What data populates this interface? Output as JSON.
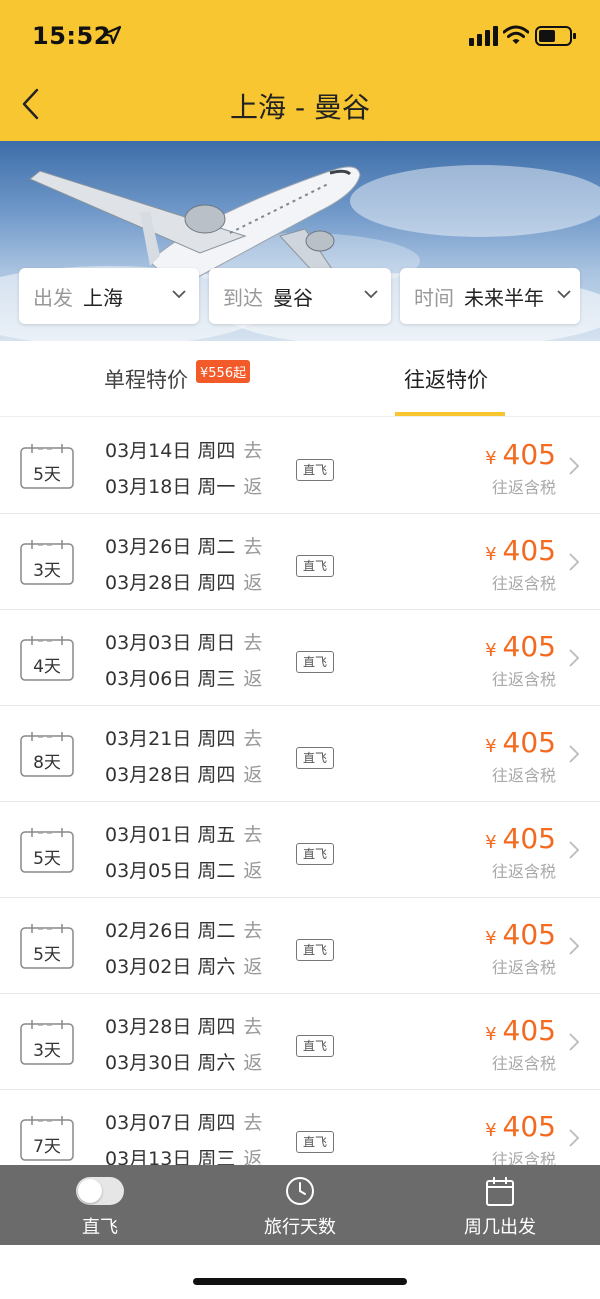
{
  "status_bar": {
    "time": "15:52"
  },
  "nav": {
    "title": "上海 - 曼谷"
  },
  "filters": [
    {
      "label": "出发",
      "value": "上海"
    },
    {
      "label": "到达",
      "value": "曼谷"
    },
    {
      "label": "时间",
      "value": "未来半年"
    }
  ],
  "tabs": {
    "one_way": {
      "label": "单程特价",
      "badge": "¥556起"
    },
    "round_trip": {
      "label": "往返特价",
      "selected": true
    }
  },
  "labels": {
    "go": "去",
    "return": "返",
    "direct": "直飞",
    "currency": "¥",
    "price_note": "往返含税"
  },
  "flights": [
    {
      "days": "5天",
      "depart": "03月14日 周四",
      "return": "03月18日 周一",
      "price": "405"
    },
    {
      "days": "3天",
      "depart": "03月26日 周二",
      "return": "03月28日 周四",
      "price": "405"
    },
    {
      "days": "4天",
      "depart": "03月03日 周日",
      "return": "03月06日 周三",
      "price": "405"
    },
    {
      "days": "8天",
      "depart": "03月21日 周四",
      "return": "03月28日 周四",
      "price": "405"
    },
    {
      "days": "5天",
      "depart": "03月01日 周五",
      "return": "03月05日 周二",
      "price": "405"
    },
    {
      "days": "5天",
      "depart": "02月26日 周二",
      "return": "03月02日 周六",
      "price": "405"
    },
    {
      "days": "3天",
      "depart": "03月28日 周四",
      "return": "03月30日 周六",
      "price": "405"
    },
    {
      "days": "7天",
      "depart": "03月07日 周四",
      "return": "03月13日 周三",
      "price": "405"
    }
  ],
  "bottom_bar": {
    "direct": {
      "label": "直飞",
      "toggle_on": false
    },
    "trip_days": {
      "label": "旅行天数",
      "icon": "clock-icon"
    },
    "weekday": {
      "label": "周几出发",
      "icon": "calendar-icon"
    }
  },
  "colors": {
    "brand_yellow": "#f7c631",
    "price_orange": "#f26b21",
    "badge_red": "#f25a2a",
    "bottom_bar": "#6b6b6b"
  }
}
